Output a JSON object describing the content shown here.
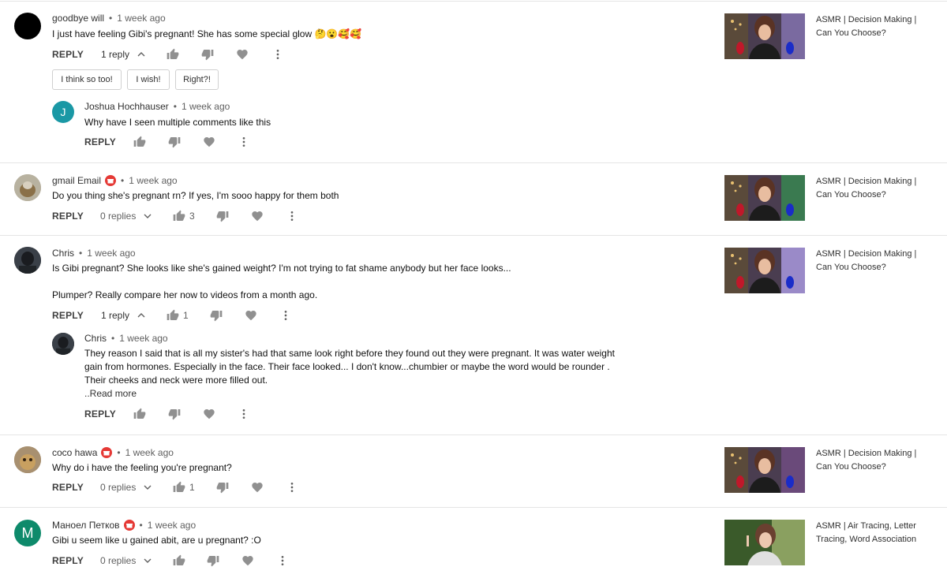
{
  "labels": {
    "reply": "REPLY",
    "read_more": "..Read more"
  },
  "chips": [
    "I think so too!",
    "I wish!",
    "Right?!"
  ],
  "comments": [
    {
      "author": "goodbye will",
      "time": "1 week ago",
      "avatar_color": "#000000",
      "text": "I just have feeling Gibi's pregnant! She has some special glow 🤔😮🥰🥰",
      "replies_label": "1 reply",
      "like_count": "",
      "video_title_1": "ASMR | Decision Making |",
      "video_title_2": "Can You Choose?"
    },
    {
      "author": "gmail Email",
      "time": "1 week ago",
      "avatar_color": "#9e9682",
      "text": "Do you thing she's pregnant rn? If yes, I'm sooo happy for them both",
      "replies_label": "0 replies",
      "like_count": "3",
      "video_title_1": "ASMR | Decision Making |",
      "video_title_2": "Can You Choose?"
    },
    {
      "author": "Chris",
      "time": "1 week ago",
      "avatar_color": "#2b2d33",
      "text_1": "Is Gibi pregnant? She looks like she's gained weight? I'm not trying to fat shame anybody but her face looks...",
      "text_2": "Plumper? Really compare her now to videos from a month ago.",
      "replies_label": "1 reply",
      "like_count": "1",
      "video_title_1": "ASMR | Decision Making |",
      "video_title_2": "Can You Choose?"
    },
    {
      "author": "coco hawa",
      "time": "1 week ago",
      "avatar_color": "#8f7454",
      "text": "Why do i have the feeling you're pregnant?",
      "replies_label": "0 replies",
      "like_count": "1",
      "video_title_1": "ASMR | Decision Making |",
      "video_title_2": "Can You Choose?"
    },
    {
      "author": "Маноел Петков",
      "time": "1 week ago",
      "avatar_color": "#0e8a6b",
      "avatar_letter": "M",
      "text": "Gibi u seem like u gained abit, are u pregnant? :O",
      "replies_label": "0 replies",
      "like_count": "",
      "video_title_1": "ASMR | Air Tracing, Letter",
      "video_title_2": "Tracing, Word Association"
    }
  ],
  "replies": [
    {
      "author": "Joshua Hochhauser",
      "time": "1 week ago",
      "avatar_color": "#1a98a5",
      "avatar_letter": "J",
      "text": "Why have I seen multiple comments like this"
    },
    {
      "author": "Chris",
      "time": "1 week ago",
      "avatar_color": "#2b2d33",
      "text": "They reason I said that is all my sister's had that same look right before they found out they were pregnant. It was water weight gain from hormones. Especially in the face. Their face looked... I don't know...chumbier or maybe the word would be rounder . Their cheeks and neck were more filled out."
    }
  ]
}
